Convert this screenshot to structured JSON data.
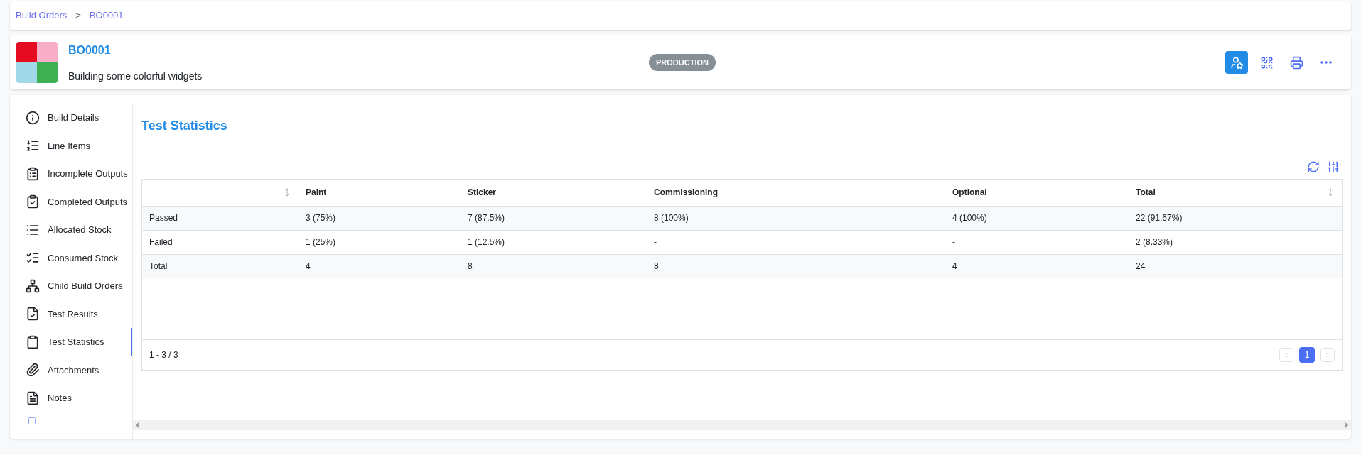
{
  "breadcrumbs": [
    {
      "label": "Build Orders"
    },
    {
      "label": "BO0001"
    }
  ],
  "breadcrumb_separator": ">",
  "header": {
    "title": "BO0001",
    "description": "Building some colorful widgets",
    "status": "PRODUCTION"
  },
  "header_actions": [
    {
      "kind": "user",
      "active": true
    },
    {
      "kind": "qr",
      "active": false
    },
    {
      "kind": "print",
      "active": false
    },
    {
      "kind": "more",
      "active": false
    }
  ],
  "sidebar": {
    "items": [
      {
        "label": "Build Details",
        "selected": false
      },
      {
        "label": "Line Items",
        "selected": false
      },
      {
        "label": "Incomplete Outputs",
        "selected": false
      },
      {
        "label": "Completed Outputs",
        "selected": false
      },
      {
        "label": "Allocated Stock",
        "selected": false
      },
      {
        "label": "Consumed Stock",
        "selected": false
      },
      {
        "label": "Child Build Orders",
        "selected": false
      },
      {
        "label": "Test Results",
        "selected": false
      },
      {
        "label": "Test Statistics",
        "selected": true
      },
      {
        "label": "Attachments",
        "selected": false
      },
      {
        "label": "Notes",
        "selected": false
      }
    ]
  },
  "panel": {
    "title": "Test Statistics"
  },
  "table": {
    "columns": [
      {},
      {
        "label": "Paint"
      },
      {
        "label": "Sticker"
      },
      {
        "label": "Commissioning"
      },
      {
        "label": "Optional"
      },
      {
        "label": "Total"
      }
    ],
    "rows": [
      [
        "Passed",
        "3 (75%)",
        "7 (87.5%)",
        "8 (100%)",
        "4 (100%)",
        "22 (91.67%)"
      ],
      [
        "Failed",
        "1 (25%)",
        "1 (12.5%)",
        "-",
        "-",
        "2 (8.33%)"
      ],
      [
        "Total",
        "4",
        "8",
        "8",
        "4",
        "24"
      ]
    ],
    "record_count": "1 - 3 / 3",
    "pages": [
      {
        "label": "1",
        "selected": true
      }
    ]
  }
}
